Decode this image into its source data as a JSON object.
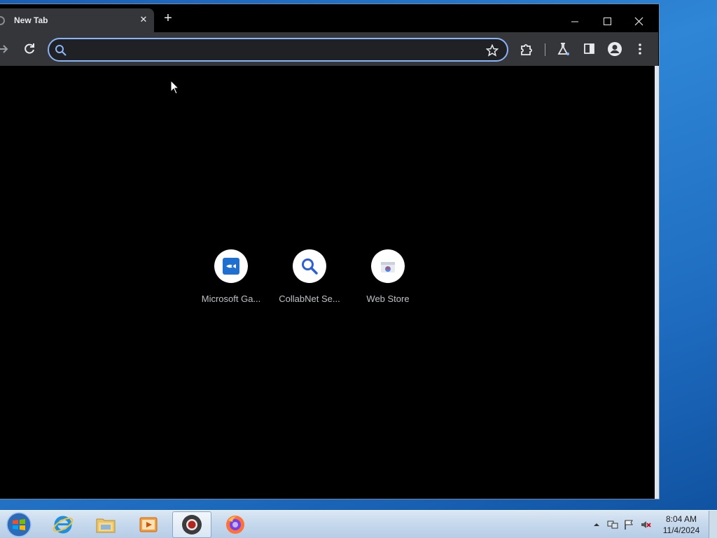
{
  "browser": {
    "tab": {
      "title": "New Tab"
    },
    "omnibox": {
      "value": "",
      "placeholder": ""
    }
  },
  "shortcuts": [
    {
      "label": "Microsoft Ga...",
      "icon": "microsoft-game-icon"
    },
    {
      "label": "CollabNet Se...",
      "icon": "search-icon"
    },
    {
      "label": "Web Store",
      "icon": "web-store-icon"
    }
  ],
  "taskbar": {
    "apps": [
      {
        "name": "internet-explorer"
      },
      {
        "name": "file-explorer"
      },
      {
        "name": "media-player"
      },
      {
        "name": "chrome",
        "active": true
      },
      {
        "name": "firefox"
      }
    ],
    "clock": {
      "time": "8:04 AM",
      "date": "11/4/2024"
    }
  },
  "colors": {
    "accent": "#8ab4f8",
    "toolbar": "#35363a",
    "omnibox_bg": "#202124",
    "page_bg": "#000000",
    "shortcut_label": "#bdc1c6"
  }
}
